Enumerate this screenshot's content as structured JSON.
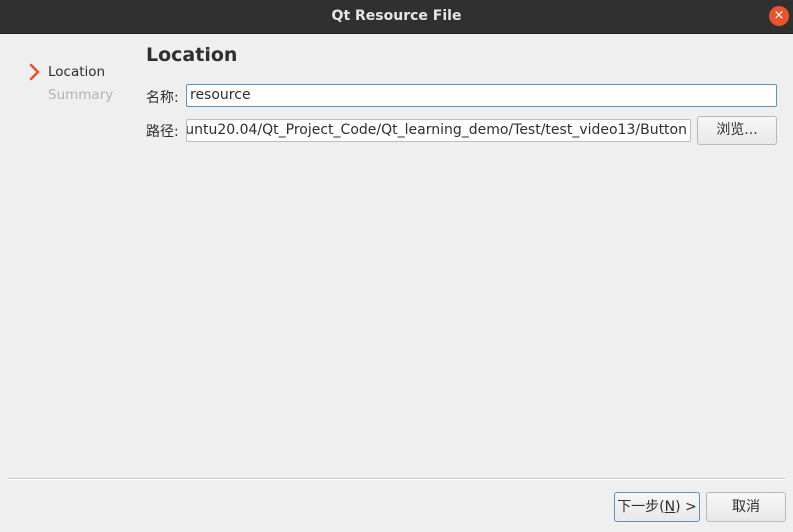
{
  "window": {
    "title": "Qt Resource File",
    "close_icon": "×"
  },
  "steps": [
    {
      "label": "Location",
      "state": "active"
    },
    {
      "label": "Summary",
      "state": "inactive"
    }
  ],
  "page": {
    "title": "Location"
  },
  "form": {
    "name_label": "名称:",
    "name_value": "resource",
    "path_label": "路径:",
    "path_value": "untu20.04/Qt_Project_Code/Qt_learning_demo/Test/test_video13/Button",
    "browse_label": "浏览..."
  },
  "footer": {
    "next_prefix": "下一步(",
    "next_mnemonic": "N",
    "next_suffix": ") >",
    "cancel_label": "取消"
  },
  "colors": {
    "accent_arrow": "#e9542b",
    "close_button": "#e9542b",
    "focus_border": "#5f8fc9",
    "titlebar": "#303030",
    "background": "#efefef"
  }
}
